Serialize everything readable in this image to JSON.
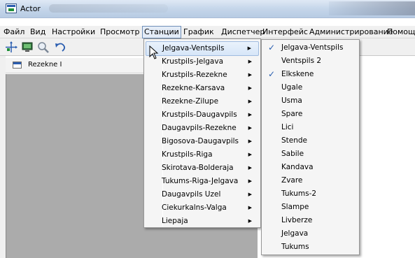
{
  "window": {
    "title": "Actor"
  },
  "menubar": {
    "items": [
      "Файл",
      "Вид",
      "Настройки",
      "Просмотр",
      "Станции",
      "График",
      "Диспетчер",
      "Интерфейс",
      "Администрирование",
      "Помощь"
    ],
    "active_item": "Станции"
  },
  "toolbar": {
    "buttons": [
      "crosshair-icon",
      "monitor-icon",
      "magnifier-icon",
      "undo-icon"
    ]
  },
  "panel": {
    "label": "Rezekne I"
  },
  "stations_menu": {
    "items": [
      "Jelgava-Ventspils",
      "Krustpils-Jelgava",
      "Krustpils-Rezekne",
      "Rezekne-Karsava",
      "Rezekne-Zilupe",
      "Krustpils-Daugavpils",
      "Daugavpils-Rezekne",
      "Bigosova-Daugavpils",
      "Krustpils-Riga",
      "Skirotava-Bolderaja",
      "Tukums-Riga-Jelgava",
      "Daugavpils Uzel",
      "Ciekurkalns-Valga",
      "Liepaja"
    ],
    "highlighted": "Jelgava-Ventspils"
  },
  "submenu": {
    "items": [
      {
        "label": "Jelgava-Ventspils",
        "checked": true
      },
      {
        "label": "Ventspils 2",
        "checked": false
      },
      {
        "label": "Elkskene",
        "checked": true
      },
      {
        "label": "Ugale",
        "checked": false
      },
      {
        "label": "Usma",
        "checked": false
      },
      {
        "label": "Spare",
        "checked": false
      },
      {
        "label": "Lici",
        "checked": false
      },
      {
        "label": "Stende",
        "checked": false
      },
      {
        "label": "Sabile",
        "checked": false
      },
      {
        "label": "Kandava",
        "checked": false
      },
      {
        "label": "Zvare",
        "checked": false
      },
      {
        "label": "Tukums-2",
        "checked": false
      },
      {
        "label": "Slampe",
        "checked": false
      },
      {
        "label": "Livberze",
        "checked": false
      },
      {
        "label": "Jelgava",
        "checked": false
      },
      {
        "label": "Tukums",
        "checked": false
      }
    ]
  },
  "colors": {
    "workspace": "#ababab",
    "menu_highlight": "#d7e6f8",
    "checkmark": "#2a5fb0"
  }
}
